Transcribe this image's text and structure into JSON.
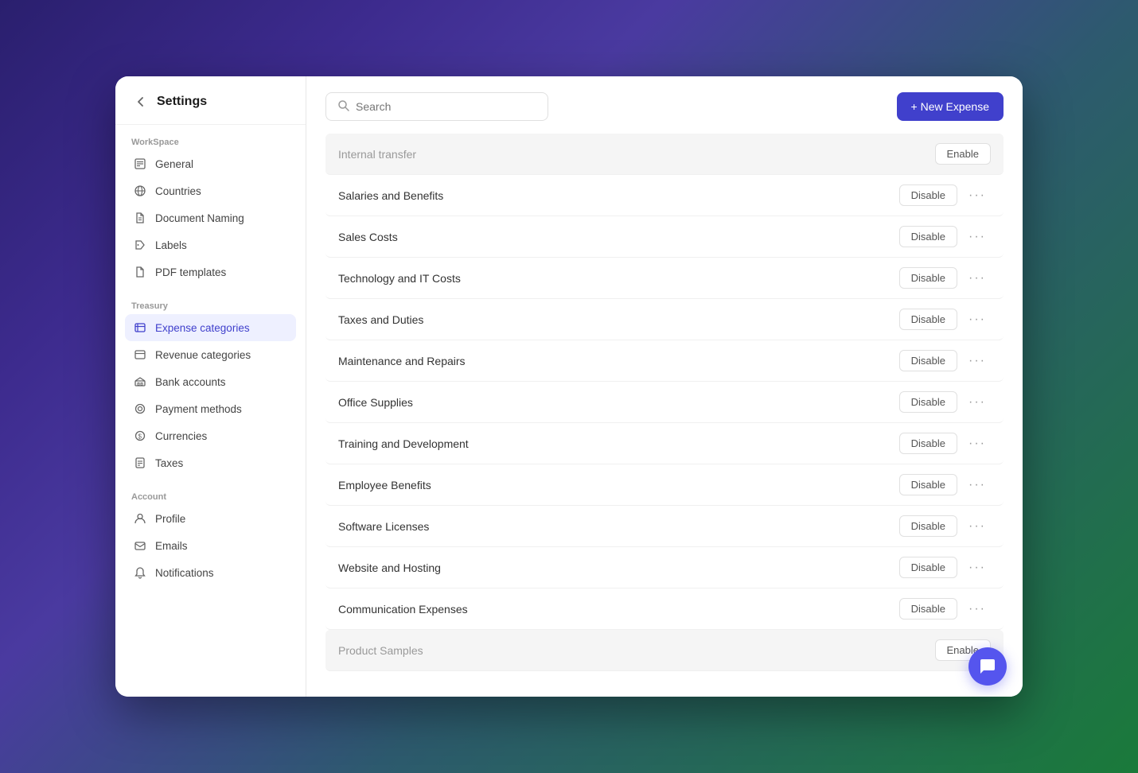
{
  "window": {
    "title": "Settings"
  },
  "sidebar": {
    "back_label": "‹",
    "title": "Settings",
    "workspace_label": "WorkSpace",
    "workspace_items": [
      {
        "id": "general",
        "label": "General",
        "icon": "🗒"
      },
      {
        "id": "countries",
        "label": "Countries",
        "icon": "🌐"
      },
      {
        "id": "document-naming",
        "label": "Document Naming",
        "icon": "📄"
      },
      {
        "id": "labels",
        "label": "Labels",
        "icon": "🏷"
      },
      {
        "id": "pdf-templates",
        "label": "PDF templates",
        "icon": "📋"
      }
    ],
    "treasury_label": "Treasury",
    "treasury_items": [
      {
        "id": "expense-categories",
        "label": "Expense categories",
        "icon": "📑",
        "active": true
      },
      {
        "id": "revenue-categories",
        "label": "Revenue categories",
        "icon": "🗂"
      },
      {
        "id": "bank-accounts",
        "label": "Bank accounts",
        "icon": "🏛"
      },
      {
        "id": "payment-methods",
        "label": "Payment methods",
        "icon": "⚙"
      },
      {
        "id": "currencies",
        "label": "Currencies",
        "icon": "💲"
      },
      {
        "id": "taxes",
        "label": "Taxes",
        "icon": "🧾"
      }
    ],
    "account_label": "Account",
    "account_items": [
      {
        "id": "profile",
        "label": "Profile",
        "icon": "👤"
      },
      {
        "id": "emails",
        "label": "Emails",
        "icon": "✉"
      },
      {
        "id": "notifications",
        "label": "Notifications",
        "icon": "🔔"
      }
    ]
  },
  "toolbar": {
    "search_placeholder": "Search",
    "new_expense_label": "+ New Expense"
  },
  "expense_rows": [
    {
      "id": "internal-transfer",
      "name": "Internal transfer",
      "action": "Enable",
      "highlighted": true,
      "show_more": false
    },
    {
      "id": "salaries-benefits",
      "name": "Salaries and Benefits",
      "action": "Disable",
      "highlighted": false,
      "show_more": true
    },
    {
      "id": "sales-costs",
      "name": "Sales Costs",
      "action": "Disable",
      "highlighted": false,
      "show_more": true
    },
    {
      "id": "technology-it-costs",
      "name": "Technology and IT Costs",
      "action": "Disable",
      "highlighted": false,
      "show_more": true
    },
    {
      "id": "taxes-duties",
      "name": "Taxes and Duties",
      "action": "Disable",
      "highlighted": false,
      "show_more": true
    },
    {
      "id": "maintenance-repairs",
      "name": "Maintenance and Repairs",
      "action": "Disable",
      "highlighted": false,
      "show_more": true
    },
    {
      "id": "office-supplies",
      "name": "Office Supplies",
      "action": "Disable",
      "highlighted": false,
      "show_more": true
    },
    {
      "id": "training-development",
      "name": "Training and Development",
      "action": "Disable",
      "highlighted": false,
      "show_more": true
    },
    {
      "id": "employee-benefits",
      "name": "Employee Benefits",
      "action": "Disable",
      "highlighted": false,
      "show_more": true
    },
    {
      "id": "software-licenses",
      "name": "Software Licenses",
      "action": "Disable",
      "highlighted": false,
      "show_more": true
    },
    {
      "id": "website-hosting",
      "name": "Website and Hosting",
      "action": "Disable",
      "highlighted": false,
      "show_more": true
    },
    {
      "id": "communication-expenses",
      "name": "Communication Expenses",
      "action": "Disable",
      "highlighted": false,
      "show_more": true
    },
    {
      "id": "product-samples",
      "name": "Product Samples",
      "action": "Enable",
      "highlighted": true,
      "show_more": false
    }
  ],
  "chat_fab": {
    "icon": "💬"
  }
}
